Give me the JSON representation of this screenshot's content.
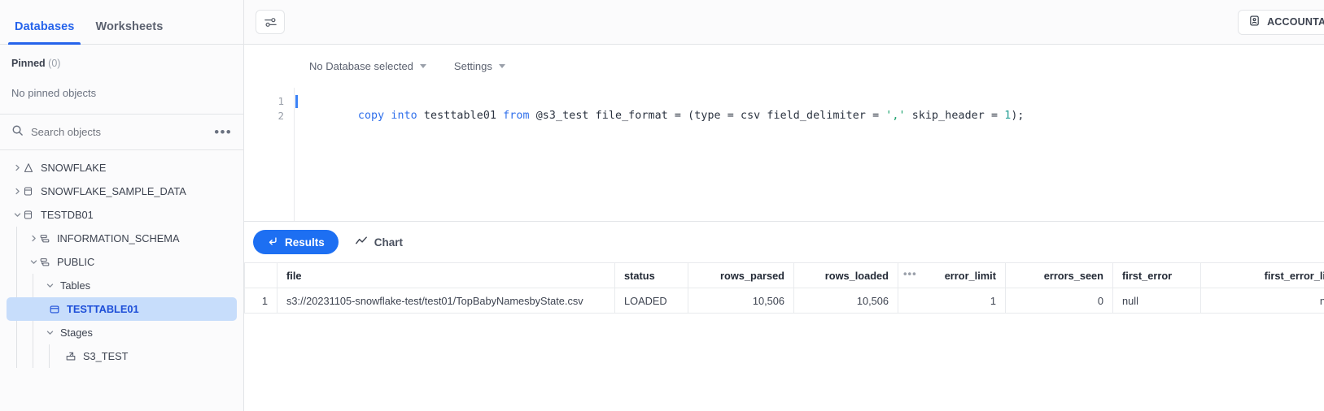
{
  "sidebar": {
    "tabs": [
      {
        "label": "Databases",
        "active": true
      },
      {
        "label": "Worksheets",
        "active": false
      }
    ],
    "pinned": {
      "title": "Pinned",
      "count": "(0)",
      "empty_text": "No pinned objects"
    },
    "search": {
      "placeholder": "Search objects",
      "icon": "search-icon",
      "more_icon": "more-horizontal-icon"
    },
    "tree": [
      {
        "label": "SNOWFLAKE",
        "depth": 0,
        "expanded": false,
        "icon": "snowflake-icon",
        "selected": false
      },
      {
        "label": "SNOWFLAKE_SAMPLE_DATA",
        "depth": 0,
        "expanded": false,
        "icon": "database-icon",
        "selected": false
      },
      {
        "label": "TESTDB01",
        "depth": 0,
        "expanded": true,
        "icon": "database-icon",
        "selected": false
      },
      {
        "label": "INFORMATION_SCHEMA",
        "depth": 1,
        "expanded": false,
        "icon": "schema-icon",
        "selected": false
      },
      {
        "label": "PUBLIC",
        "depth": 1,
        "expanded": true,
        "icon": "schema-icon",
        "selected": false
      },
      {
        "label": "Tables",
        "depth": 2,
        "expanded": true,
        "icon": "none",
        "selected": false
      },
      {
        "label": "TESTTABLE01",
        "depth": 3,
        "expanded": null,
        "icon": "table-icon",
        "selected": true
      },
      {
        "label": "Stages",
        "depth": 2,
        "expanded": true,
        "icon": "none",
        "selected": false
      },
      {
        "label": "S3_TEST",
        "depth": 3,
        "expanded": null,
        "icon": "stage-icon",
        "selected": false
      }
    ]
  },
  "topbar": {
    "filter_icon": "sliders-icon",
    "account_label": "ACCOUNTADMIN",
    "account_icon": "id-badge-icon"
  },
  "querybar": {
    "database_selector": "No Database selected",
    "settings": "Settings"
  },
  "editor": {
    "line_numbers": [
      "1",
      "2"
    ],
    "tokens": [
      {
        "t": "copy into",
        "c": "kw"
      },
      {
        "t": " testtable01 ",
        "c": "plain"
      },
      {
        "t": "from",
        "c": "kw"
      },
      {
        "t": " @s3_test file_format = (type = csv field_delimiter = ",
        "c": "plain"
      },
      {
        "t": "','",
        "c": "str"
      },
      {
        "t": " skip_header = ",
        "c": "plain"
      },
      {
        "t": "1",
        "c": "num"
      },
      {
        "t": ");",
        "c": "plain"
      }
    ],
    "full_text": "copy into testtable01 from @s3_test file_format = (type = csv field_delimiter = ',' skip_header = 1);"
  },
  "results": {
    "tabs": [
      {
        "label": "Results",
        "icon": "arrow-return-icon",
        "active": true
      },
      {
        "label": "Chart",
        "icon": "line-chart-icon",
        "active": false
      }
    ],
    "columns": [
      "file",
      "status",
      "rows_parsed",
      "rows_loaded",
      "error_limit",
      "errors_seen",
      "first_error",
      "first_error_li"
    ],
    "rows": [
      {
        "n": "1",
        "file": "s3://20231105-snowflake-test/test01/TopBabyNamesbyState.csv",
        "status": "LOADED",
        "rows_parsed": "10,506",
        "rows_loaded": "10,506",
        "error_limit": "1",
        "errors_seen": "0",
        "first_error": "null",
        "first_error_li": "n"
      }
    ]
  },
  "colors": {
    "accent": "#2563eb",
    "pill": "#1d6ff2",
    "selection": "#c7ddfb",
    "keyword": "#2f6feb",
    "string": "#16a06a",
    "number": "#2aa198"
  }
}
